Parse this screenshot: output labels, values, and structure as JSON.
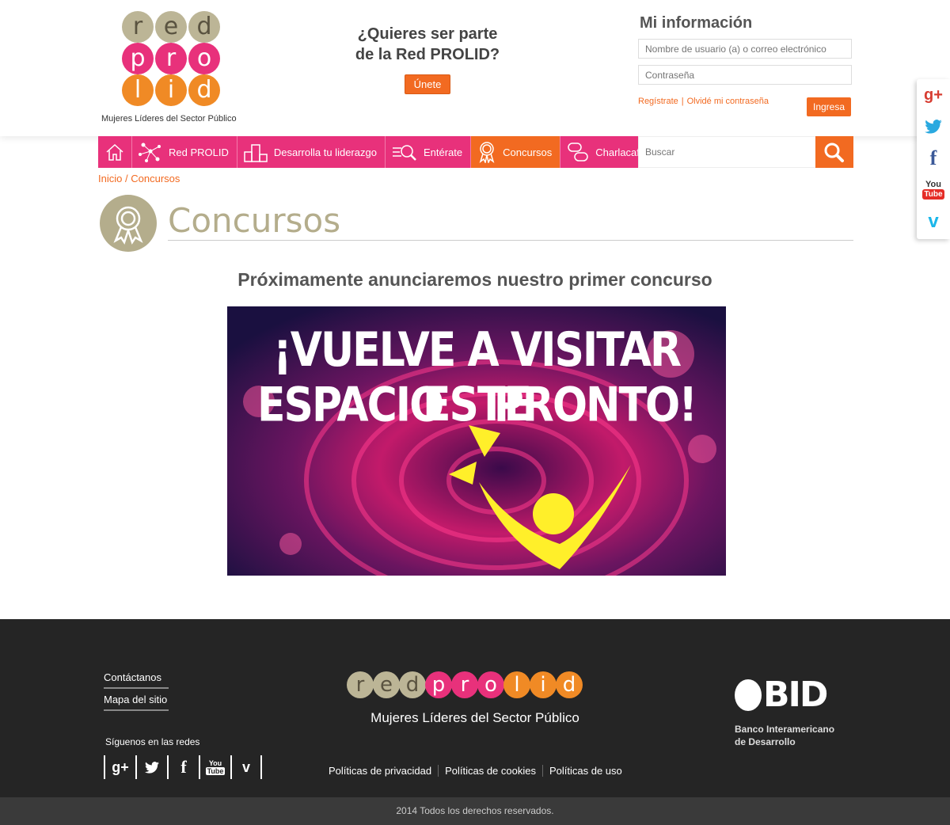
{
  "header": {
    "logo": {
      "rows": [
        [
          "r",
          "e",
          "d"
        ],
        [
          "p",
          "r",
          "o"
        ],
        [
          "l",
          "i",
          "d"
        ]
      ],
      "tagline": "Mujeres Líderes del Sector Público"
    },
    "cta": {
      "line1": "¿Quieres ser parte",
      "line2": "de la Red PROLID?",
      "button": "Únete"
    },
    "login": {
      "title": "Mi información",
      "user_placeholder": "Nombre de usuario (a) o correo electrónico",
      "password_placeholder": "Contraseña",
      "register_link": "Regístrate",
      "forgot_link": "Olvidé mi contraseña",
      "separator": "|",
      "submit": "Ingresa"
    }
  },
  "social_sidebar": {
    "gplus": "g+",
    "twitter": "t",
    "facebook": "f",
    "youtube_top": "You",
    "youtube_bottom": "Tube",
    "vimeo": "v"
  },
  "nav": {
    "items": [
      {
        "label": "",
        "icon": "home-icon"
      },
      {
        "label": "Red PROLID",
        "icon": "network-icon"
      },
      {
        "label": "Desarrolla tu liderazgo",
        "icon": "podium-icon"
      },
      {
        "label": "Entérate",
        "icon": "news-search-icon"
      },
      {
        "label": "Concursos",
        "icon": "award-icon",
        "active": true
      },
      {
        "label": "Charlacafé",
        "icon": "chat-icon"
      }
    ],
    "search_placeholder": "Buscar"
  },
  "breadcrumb": {
    "home": "Inicio",
    "separator": "/",
    "current": "Concursos"
  },
  "page": {
    "title": "Concursos",
    "subtitle": "Próximamente anunciaremos nuestro primer concurso",
    "banner": {
      "line1": "¡VUELVE A VISITAR ESTE",
      "line2": "ESPACIO    PRONTO!"
    }
  },
  "footer": {
    "links": [
      "Contáctanos",
      "Mapa del sitio"
    ],
    "follow_label": "Síguenos en las redes",
    "social": {
      "gplus": "g+",
      "twitter": "t",
      "facebook": "f",
      "youtube_top": "You",
      "youtube_bottom": "Tube",
      "vimeo": "v"
    },
    "logo_letters": [
      "r",
      "e",
      "d",
      "p",
      "r",
      "o",
      "l",
      "i",
      "d"
    ],
    "tagline": "Mujeres Líderes del Sector Público",
    "policies": [
      "Políticas de privacidad",
      "Políticas de cookies",
      "Políticas de uso"
    ],
    "bid": {
      "logo_text": "BID",
      "name_line1": "Banco Interamericano",
      "name_line2": "de Desarrollo"
    },
    "copyright": "2014 Todos los derechos reservados."
  },
  "colors": {
    "pink": "#e8317b",
    "orange": "#f26a21",
    "olive": "#b4ad8c",
    "footer_bg": "#252525"
  }
}
